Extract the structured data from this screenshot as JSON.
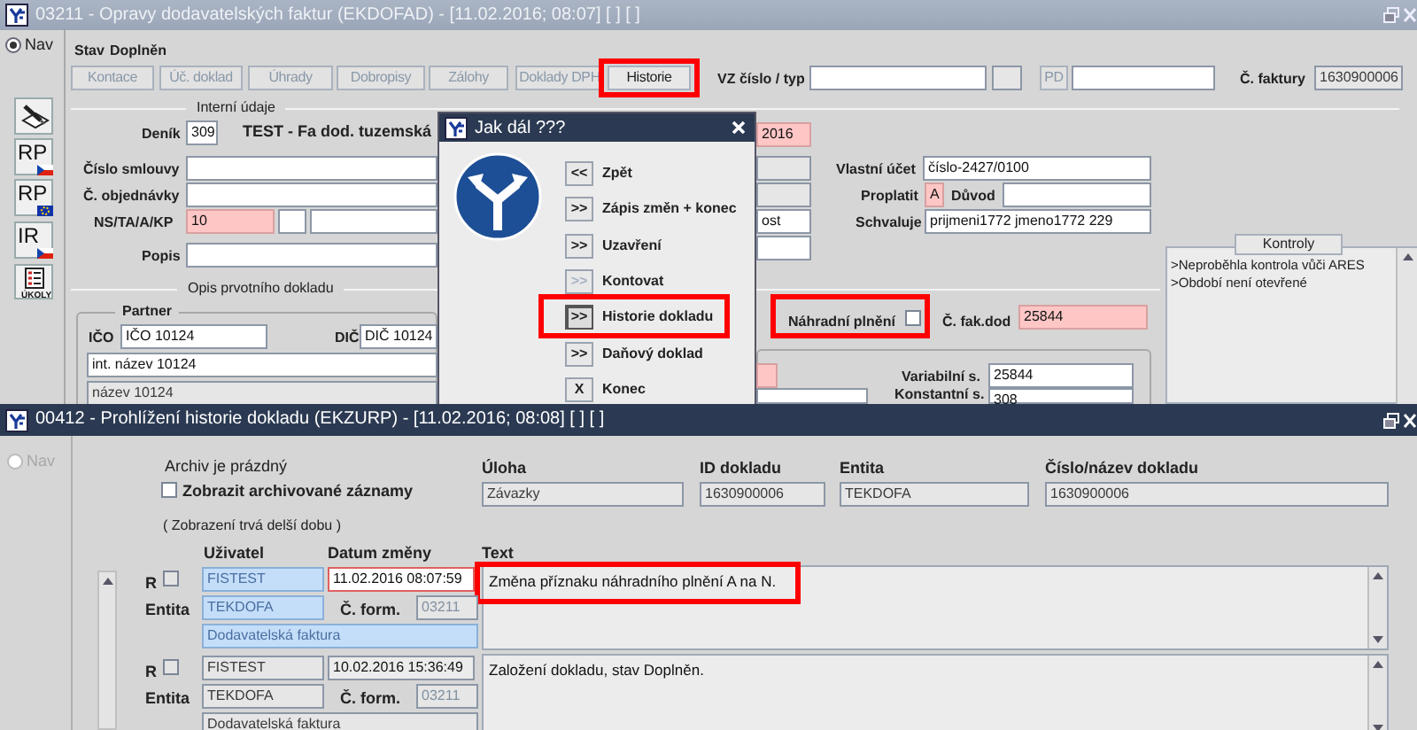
{
  "back_window": {
    "title": "03211 - Opravy dodavatelských faktur (EKDOFAD) - [11.02.2016; 08:07]  [ ]  [ ]",
    "active": false,
    "nav": {
      "label": "Nav",
      "selected": true
    },
    "toolbar": [
      {
        "kind": "edit"
      },
      {
        "kind": "badge",
        "text": "RP",
        "eu_flag": false
      },
      {
        "kind": "badge",
        "text": "RP",
        "eu_flag": true
      },
      {
        "kind": "badge",
        "text": "IR",
        "eu_flag": false
      },
      {
        "kind": "tasks",
        "text": "ÚKOLY"
      }
    ],
    "items": [
      {
        "kind": "label",
        "text": "Stav"
      },
      {
        "kind": "value",
        "text": "Doplněn"
      },
      {
        "kind": "button",
        "text": "Kontace",
        "disabled": true,
        "highlighted": false
      },
      {
        "kind": "button",
        "text": "Úč. doklad",
        "disabled": true,
        "highlighted": false
      },
      {
        "kind": "button",
        "text": "Úhrady",
        "disabled": true,
        "highlighted": false
      },
      {
        "kind": "button",
        "text": "Dobropisy",
        "disabled": true,
        "highlighted": false
      },
      {
        "kind": "button",
        "text": "Zálohy",
        "disabled": true,
        "highlighted": false
      },
      {
        "kind": "button",
        "text": "Doklady DPH",
        "disabled": true,
        "highlighted": false
      },
      {
        "kind": "button",
        "text": "Historie",
        "disabled": false,
        "highlighted": true
      },
      {
        "kind": "label",
        "text": "VZ číslo / typ"
      },
      {
        "kind": "field",
        "required": false,
        "readonly": false
      },
      {
        "kind": "field",
        "required": false,
        "readonly": true
      },
      {
        "kind": "button",
        "text": "PD",
        "disabled": true,
        "highlighted": false
      },
      {
        "kind": "field",
        "required": false,
        "readonly": false
      },
      {
        "kind": "label",
        "text": "Č. faktury"
      },
      {
        "kind": "field",
        "required": false,
        "readonly": true,
        "value": "1630900006"
      },
      {
        "kind": "section",
        "text": "Interní údaje"
      },
      {
        "kind": "label",
        "text": "Deník"
      },
      {
        "kind": "field",
        "required": false,
        "readonly": false,
        "value": "309"
      },
      {
        "kind": "value",
        "text": "TEST - Fa dod. tuzemská"
      },
      {
        "kind": "field",
        "required": true,
        "readonly": false,
        "value": "2016"
      },
      {
        "kind": "label",
        "text": "Číslo smlouvy"
      },
      {
        "kind": "field",
        "required": false,
        "readonly": false
      },
      {
        "kind": "field",
        "required": false,
        "readonly": true
      },
      {
        "kind": "label",
        "text": "Vlastní účet"
      },
      {
        "kind": "field",
        "required": false,
        "readonly": false,
        "value": "číslo-2427/0100"
      },
      {
        "kind": "label",
        "text": "Č. objednávky"
      },
      {
        "kind": "field",
        "required": false,
        "readonly": false
      },
      {
        "kind": "field",
        "required": false,
        "readonly": true
      },
      {
        "kind": "label",
        "text": "Proplatit"
      },
      {
        "kind": "field",
        "required": true,
        "readonly": false,
        "value": "A"
      },
      {
        "kind": "label",
        "text": "Důvod"
      },
      {
        "kind": "field",
        "required": false,
        "readonly": false
      },
      {
        "kind": "label",
        "text": "NS/TA/A/KP"
      },
      {
        "kind": "field",
        "required": true,
        "readonly": false,
        "value": "10"
      },
      {
        "kind": "field",
        "required": false,
        "readonly": false
      },
      {
        "kind": "field",
        "required": false,
        "readonly": false
      },
      {
        "kind": "field",
        "required": false,
        "readonly": false,
        "value": "ost"
      },
      {
        "kind": "label",
        "text": "Schvaluje"
      },
      {
        "kind": "field",
        "required": false,
        "readonly": false,
        "value": "prijmeni1772 jmeno1772 229"
      },
      {
        "kind": "label",
        "text": "Popis"
      },
      {
        "kind": "field",
        "required": false,
        "readonly": false
      },
      {
        "kind": "field",
        "required": false,
        "readonly": false
      },
      {
        "kind": "section",
        "text": "Opis prvotního dokladu"
      },
      {
        "kind": "group",
        "text": "Partner"
      },
      {
        "kind": "label",
        "text": "IČO"
      },
      {
        "kind": "field",
        "required": false,
        "readonly": false,
        "value": "IČO 10124"
      },
      {
        "kind": "label",
        "text": "DIČ"
      },
      {
        "kind": "field",
        "required": false,
        "readonly": false,
        "value": "DIČ 10124"
      },
      {
        "kind": "field",
        "required": false,
        "readonly": false,
        "value": "int. název 10124"
      },
      {
        "kind": "field",
        "required": false,
        "readonly": true,
        "value": "název 10124"
      },
      {
        "kind": "label",
        "text": "Náhradní plnění"
      },
      {
        "kind": "checkbox",
        "checked": false,
        "highlighted": true
      },
      {
        "kind": "label",
        "text": "Č. fak.dod"
      },
      {
        "kind": "field",
        "required": true,
        "readonly": false,
        "value": "25844"
      },
      {
        "kind": "group"
      },
      {
        "kind": "field",
        "required": true,
        "readonly": false
      },
      {
        "kind": "label",
        "text": "Variabilní s."
      },
      {
        "kind": "field",
        "required": false,
        "readonly": false,
        "value": "25844"
      },
      {
        "kind": "field",
        "required": false,
        "readonly": false
      },
      {
        "kind": "label",
        "text": "Konstantní s."
      },
      {
        "kind": "field",
        "required": false,
        "readonly": false,
        "value": "308"
      }
    ],
    "checks": {
      "title": "Kontroly",
      "messages": [
        ">Neproběhla kontrola vůči ARES",
        ">Období není otevřené"
      ]
    }
  },
  "dialog": {
    "title": "Jak dál ???",
    "buttons": [
      {
        "key": "<<",
        "label": "Zpět",
        "disabled": false,
        "pressed": false,
        "highlighted": false
      },
      {
        "key": ">>",
        "label": "Zápis změn + konec",
        "disabled": false,
        "pressed": false,
        "highlighted": false
      },
      {
        "key": ">>",
        "label": "Uzavření",
        "disabled": false,
        "pressed": false,
        "highlighted": false
      },
      {
        "key": ">>",
        "label": "Kontovat",
        "disabled": true,
        "pressed": false,
        "highlighted": false
      },
      {
        "key": ">>",
        "label": "Historie dokladu",
        "disabled": false,
        "pressed": true,
        "highlighted": true
      },
      {
        "key": ">>",
        "label": "Daňový doklad",
        "disabled": false,
        "pressed": false,
        "highlighted": false
      },
      {
        "key": "X",
        "label": "Konec",
        "disabled": false,
        "pressed": false,
        "highlighted": false
      }
    ]
  },
  "front_window": {
    "title": "00412 - Prohlížení historie dokladu (EKZURP) - [11.02.2016; 08:08]  [ ]  [ ]",
    "active": true,
    "nav": {
      "label": "Nav",
      "selected": false,
      "disabled": true
    },
    "archive_note": "Archiv je prázdný",
    "show_archived": {
      "label": "Zobrazit archivované záznamy",
      "checked": false
    },
    "hint": "( Zobrazení trvá delší dobu )",
    "header_fields": [
      {
        "label": "Úloha",
        "value": "Závazky"
      },
      {
        "label": "ID dokladu",
        "value": "1630900006"
      },
      {
        "label": "Entita",
        "value": "TEKDOFA"
      },
      {
        "label": "Číslo/název dokladu",
        "value": "1630900006"
      }
    ],
    "columns": [
      "Uživatel",
      "Datum změny",
      "Text"
    ],
    "records": [
      {
        "r_label": "R",
        "r_checked": false,
        "user": "FISTEST",
        "date": "11.02.2016 08:07:59",
        "text": "Změna příznaku náhradního plnění A na N.",
        "entity_label": "Entita",
        "entity": "TEKDOFA",
        "form_label": "Č. form.",
        "form": "03211",
        "doc_type": "Dodavatelská faktura",
        "current": true,
        "highlighted": true
      },
      {
        "r_label": "R",
        "r_checked": false,
        "user": "FISTEST",
        "date": "10.02.2016 15:36:49",
        "text": "Založení dokladu, stav Doplněn.",
        "entity_label": "Entita",
        "entity": "TEKDOFA",
        "form_label": "Č. form.",
        "form": "03211",
        "doc_type": "Dodavatelská faktura",
        "current": false,
        "highlighted": false
      }
    ]
  }
}
